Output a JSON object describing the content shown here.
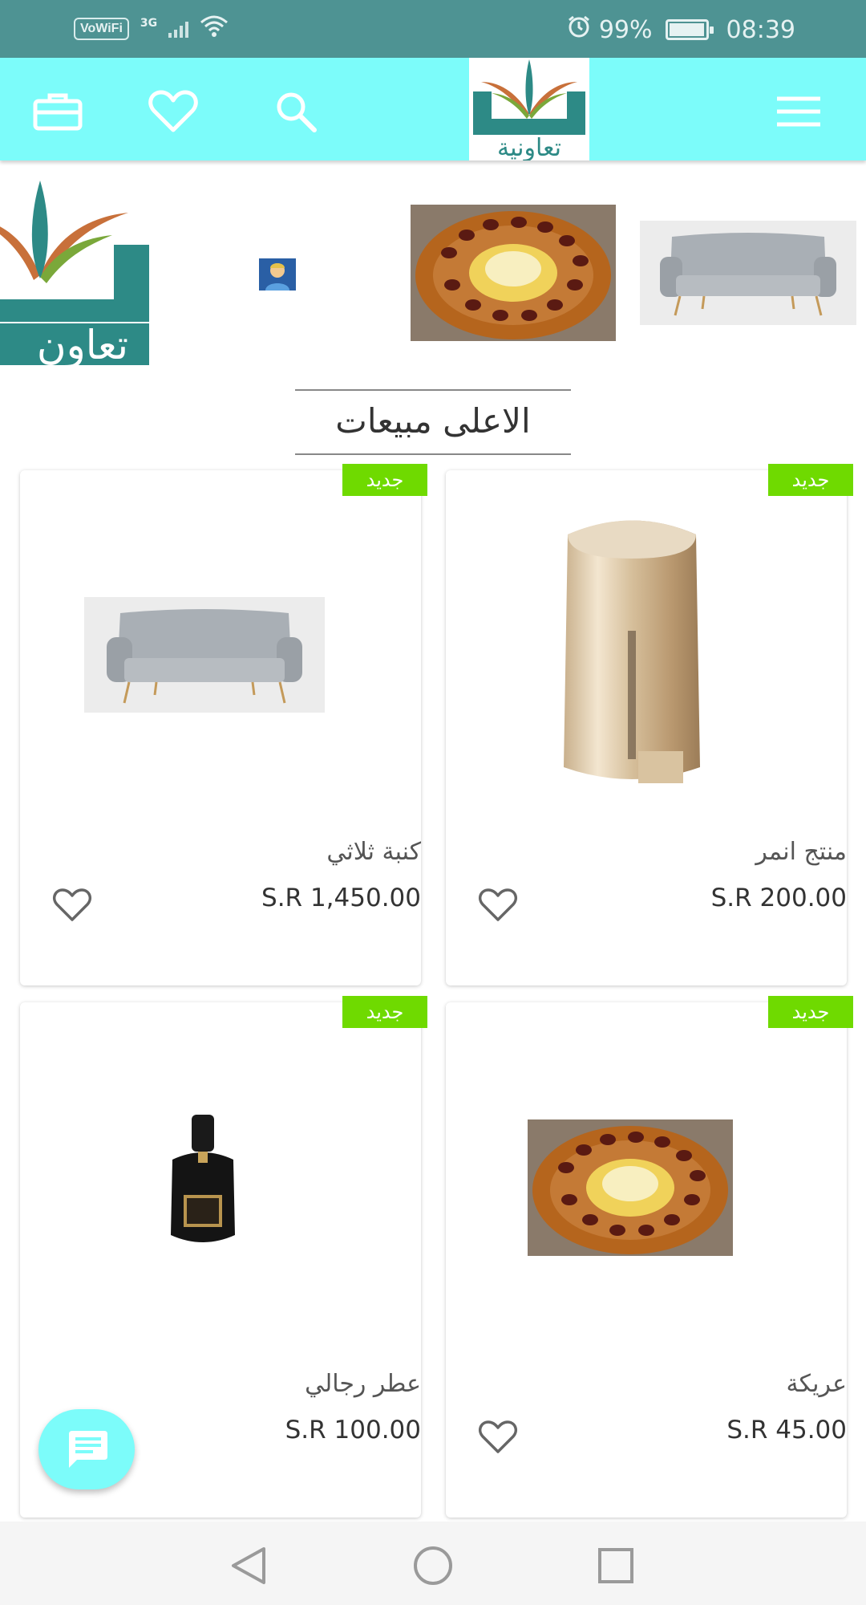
{
  "status_bar": {
    "vowifi": "VoWiFi",
    "network": "3G",
    "battery": "99%",
    "battery_level": 0.99,
    "time": "08:39"
  },
  "header": {
    "logo_text": "تعاونية",
    "icons": [
      "briefcase-icon",
      "heart-icon",
      "search-icon",
      "menu-icon"
    ]
  },
  "banner": {
    "logo_text": "تعاون"
  },
  "section": {
    "title": "الاعلى مبيعات"
  },
  "products": [
    {
      "badge": "جديد",
      "name": "منتج انمر",
      "price": "S.R 200.00"
    },
    {
      "badge": "جديد",
      "name": "كنبة ثلاثي",
      "price": "S.R 1,450.00"
    },
    {
      "badge": "جديد",
      "name": "عريكة",
      "price": "S.R 45.00"
    },
    {
      "badge": "جديد",
      "name": "عطر رجالي",
      "price": "S.R 100.00"
    }
  ],
  "colors": {
    "status_bar": "#4e9393",
    "header": "#7cfcfa",
    "badge": "#6fda00",
    "logo_teal": "#2d8a86",
    "logo_green": "#7aa83a",
    "logo_orange": "#c8703a"
  }
}
